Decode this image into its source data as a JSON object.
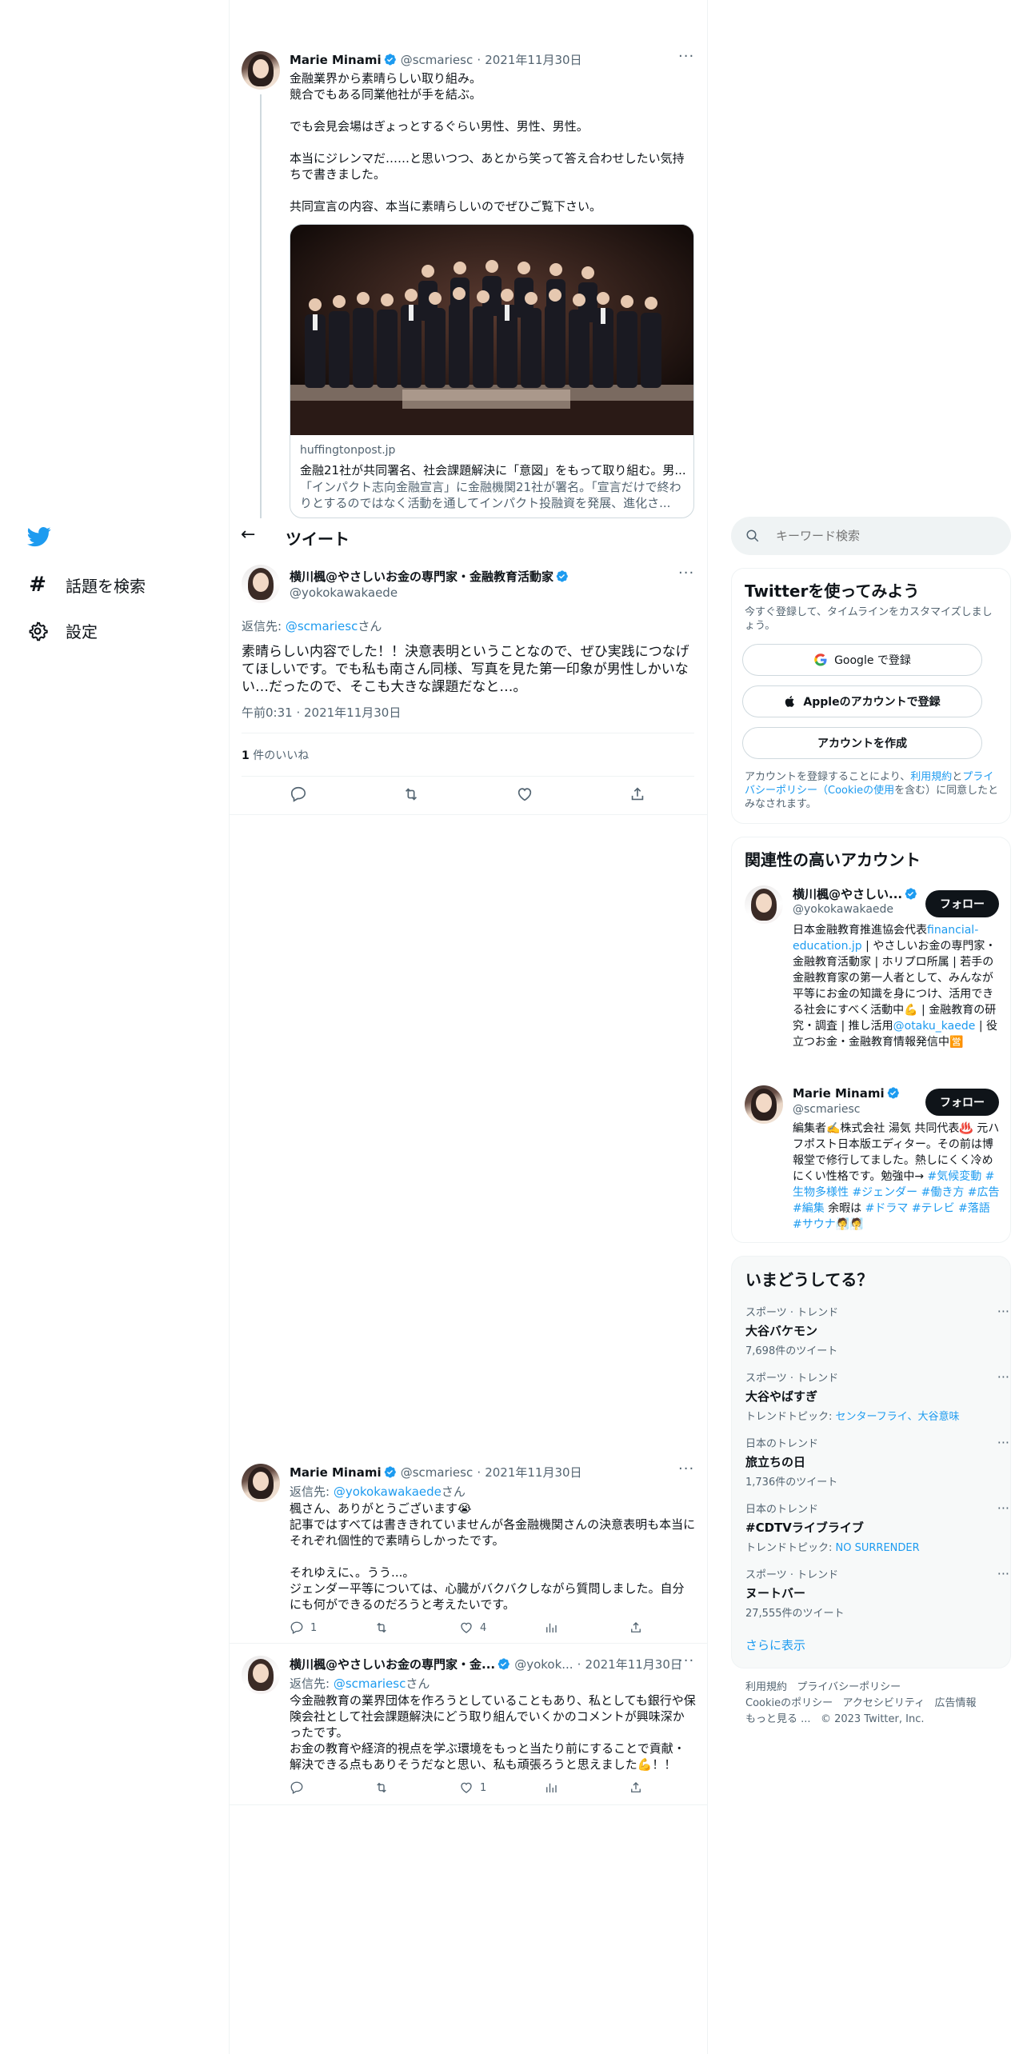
{
  "nav": {
    "items": [
      {
        "label": "話題を検索",
        "icon": "hashtag-icon"
      },
      {
        "label": "設定",
        "icon": "gear-icon"
      }
    ]
  },
  "main": {
    "header_title": "ツイート",
    "parent_tweet": {
      "name": "Marie Minami",
      "handle": "@scmariesc",
      "sep": "·",
      "date": "2021年11月30日",
      "text": "金融業界から素晴らしい取り組み。\n競合でもある同業他社が手を結ぶ。\n\nでも会見会場はぎょっとするぐらい男性、男性、男性。\n\n本当にジレンマだ……と思いつつ、あとから笑って答え合わせしたい気持ちで書きました。\n\n共同宣言の内容、本当に素晴らしいのでぜひご覧下さい。",
      "card_domain": "huffingtonpost.jp",
      "card_title": "金融21社が共同署名、社会課題解決に「意図」をもって取り組む。男...",
      "card_desc": "「インパクト志向金融宣言」に金融機関21社が署名。「宣言だけで終わりとするのではなく活動を通してインパクト投融資を発展、進化さ..."
    },
    "focus_tweet": {
      "name": "横川楓@やさしいお金の専門家・金融教育活動家",
      "handle": "@yokokawakaede",
      "reply_prefix": "返信先:",
      "reply_to": "@scmariesc",
      "reply_suffix": "さん",
      "text": "素晴らしい内容でした！！決意表明ということなので、ぜひ実践につなげてほしいです。でも私も南さん同様、写真を見た第一印象が男性しかいない…だったので、そこも大きな課題だなと…。",
      "time": "午前0:31 · 2021年11月30日",
      "likes_count": "1",
      "likes_label": "件のいいね"
    },
    "replies": [
      {
        "name": "Marie Minami",
        "handle": "@scmariesc",
        "sep": "·",
        "date": "2021年11月30日",
        "reply_prefix": "返信先:",
        "reply_to": "@yokokawakaede",
        "reply_suffix": "さん",
        "text": "楓さん、ありがとうございます😭\n記事ではすべては書ききれていませんが各金融機関さんの決意表明も本当にそれぞれ個性的で素晴らしかったです。\n\nそれゆえに、。うう...。\nジェンダー平等については、心臓がバクバクしながら質問しました。自分にも何ができるのだろうと考えたいです。",
        "replies_count": "1",
        "retweets_count": "",
        "likes_count": "4"
      },
      {
        "name": "横川楓@やさしいお金の専門家・金...",
        "handle": "@yokok...",
        "sep": "·",
        "date": "2021年11月30日",
        "reply_prefix": "返信先:",
        "reply_to": "@scmariesc",
        "reply_suffix": "さん",
        "text": "今金融教育の業界団体を作ろうとしていることもあり、私としても銀行や保険会社として社会課題解決にどう取り組んでいくかのコメントが興味深かったです。\nお金の教育や経済的視点を学ぶ環境をもっと当たり前にすることで貢献・解決できる点もありそうだなと思い、私も頑張ろうと思えました💪！！",
        "replies_count": "",
        "retweets_count": "",
        "likes_count": "1"
      }
    ]
  },
  "sidebar": {
    "search_placeholder": "キーワード検索",
    "signup": {
      "title": "Twitterを使ってみよう",
      "subtitle": "今すぐ登録して、タイムラインをカスタマイズしましょう。",
      "google_label": "Google で登録",
      "apple_label": "Appleのアカウントで登録",
      "create_label": "アカウントを作成",
      "legal_1": "アカウントを登録することにより、",
      "legal_terms": "利用規約",
      "legal_and": "と",
      "legal_privacy": "プライバシーポリシー",
      "legal_cookie_open": "（",
      "legal_cookie": "Cookieの使用",
      "legal_2": "を含む）に同意したとみなされます。"
    },
    "related": {
      "title": "関連性の高いアカウント",
      "accounts": [
        {
          "name": "横川楓@やさしい...",
          "handle": "@yokokawakaede",
          "follow_label": "フォロー",
          "bio_1": "日本金融教育推進協会代表",
          "bio_link": "financial-education.jp",
          "bio_2": " | やさしいお金の専門家・金融教育活動家 | ホリプロ所属 | 若手の金融教育家の第一人者として、みんなが平等にお金の知識を身につけ、活用できる社会にすべく活動中💪 | 金融教育の研究・調査 | 推し活用",
          "bio_link2": "@otaku_kaede",
          "bio_3": " | 役立つお金・金融教育情報発信中🈺"
        },
        {
          "name": "Marie Minami",
          "handle": "@scmariesc",
          "follow_label": "フォロー",
          "bio_1": "編集者✍️株式会社 湯気 共同代表♨️ 元ハフポスト日本版エディター。その前は博報堂で修行してました。熱しにくく冷めにくい性格です。勉強中→ ",
          "bio_tags1": "#気候変動 #生物多様性 #ジェンダー #働き方 #広告 #編集",
          "bio_mid": " 余暇は ",
          "bio_tags2": "#ドラマ #テレビ #落語 #サウナ",
          "bio_end": "🧖🧖"
        }
      ]
    },
    "trends": {
      "title": "いまどうしてる？",
      "items": [
        {
          "category": "スポーツ · トレンド",
          "name": "大谷バケモン",
          "sub": "7,698件のツイート"
        },
        {
          "category": "スポーツ · トレンド",
          "name": "大谷やばすぎ",
          "sub_label": "トレンドトピック: ",
          "sub_links": "センターフライ、大谷意味"
        },
        {
          "category": "日本のトレンド",
          "name": "旅立ちの日",
          "sub": "1,736件のツイート"
        },
        {
          "category": "日本のトレンド",
          "name": "#CDTVライブライブ",
          "sub_label": "トレンドトピック: ",
          "sub_links": "NO SURRENDER"
        },
        {
          "category": "スポーツ · トレンド",
          "name": "ヌートバー",
          "sub": "27,555件のツイート"
        }
      ],
      "show_more": "さらに表示"
    },
    "footer": {
      "links": [
        "利用規約",
        "プライバシーポリシー",
        "Cookieのポリシー",
        "アクセシビリティ",
        "広告情報",
        "もっと見る ..."
      ],
      "copyright": "© 2023 Twitter, Inc."
    }
  },
  "colors": {
    "accent": "#1d9bf0",
    "text": "#0f1419",
    "muted": "#536471",
    "border": "#eff3f4"
  }
}
